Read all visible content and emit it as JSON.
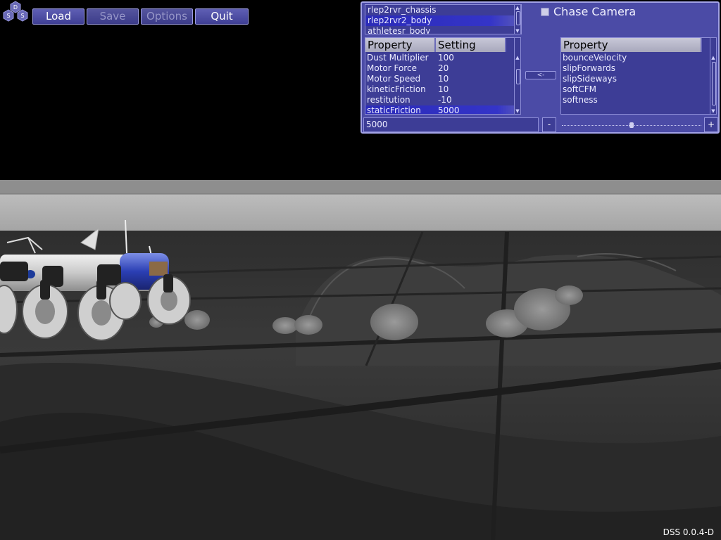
{
  "logo": {
    "letters": [
      "D",
      "S",
      "S"
    ]
  },
  "toolbar": {
    "load_label": "Load",
    "save_label": "Save",
    "options_label": "Options",
    "quit_label": "Quit"
  },
  "objects": {
    "items": [
      "rlep2rvr_chassis",
      "rlep2rvr2_body",
      "athletesr_body"
    ],
    "selected_index": 1
  },
  "chase_camera": {
    "label": "Chase Camera",
    "checked": false
  },
  "settings_table": {
    "headers": [
      "Property",
      "Setting"
    ],
    "rows": [
      [
        "Dust Multiplier",
        "100"
      ],
      [
        "Motor Force",
        "20"
      ],
      [
        "Motor Speed",
        "10"
      ],
      [
        "kineticFriction",
        "10"
      ],
      [
        "restitution",
        "-10"
      ],
      [
        "staticFriction",
        "5000"
      ]
    ],
    "selected_index": 5
  },
  "property_table": {
    "header": "Property",
    "rows": [
      "bounceVelocity",
      "slipForwards",
      "slipSideways",
      "softCFM",
      "softness"
    ]
  },
  "move_button_label": "<-",
  "value_input": {
    "value": "5000"
  },
  "minus_label": "-",
  "plus_label": "+",
  "slider": {
    "value_fraction": 0.5
  },
  "version": "DSS 0.0.4-D",
  "colors": {
    "panel": "#4b4ba6",
    "panel_border": "#a2a2e6",
    "selection": "#3030c0",
    "button": "#4f4fa4"
  }
}
